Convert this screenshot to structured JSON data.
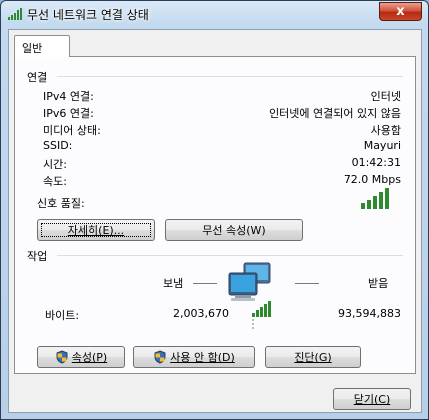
{
  "window": {
    "title": "무선 네트워크 연결 상태",
    "close_glyph": "x"
  },
  "tabs": [
    {
      "label": "일반",
      "selected": true
    }
  ],
  "connection": {
    "heading": "연결",
    "rows": [
      {
        "label": "IPv4 연결:",
        "value": "인터넷"
      },
      {
        "label": "IPv6 연결:",
        "value": "인터넷에 연결되어 있지 않음"
      },
      {
        "label": "미디어 상태:",
        "value": "사용함"
      },
      {
        "label": "SSID:",
        "value": "Mayuri"
      },
      {
        "label": "시간:",
        "value": "01:42:31"
      },
      {
        "label": "속도:",
        "value": "72.0 Mbps"
      }
    ],
    "signal_label": "신호 품질:",
    "signal_bars": 5,
    "details_button": "자세히(E)...",
    "wireless_props_button": "무선 속성(W)"
  },
  "activity": {
    "heading": "작업",
    "sent_label": "보냄",
    "received_label": "받음",
    "bytes_label": "바이트:",
    "bytes_sent": "2,003,670",
    "bytes_received": "93,594,883"
  },
  "buttons": {
    "properties": "속성(P)",
    "disable": "사용 안 함(D)",
    "diagnose": "진단(G)",
    "close": "닫기(C)"
  },
  "colors": {
    "signal_green": "#2f8a2f",
    "title_bar": "#c3d9ee",
    "close_red": "#c9472b"
  },
  "icons": {
    "title": "network-signal-icon",
    "activity": "network-computers-icon",
    "shield": "uac-shield-icon"
  }
}
